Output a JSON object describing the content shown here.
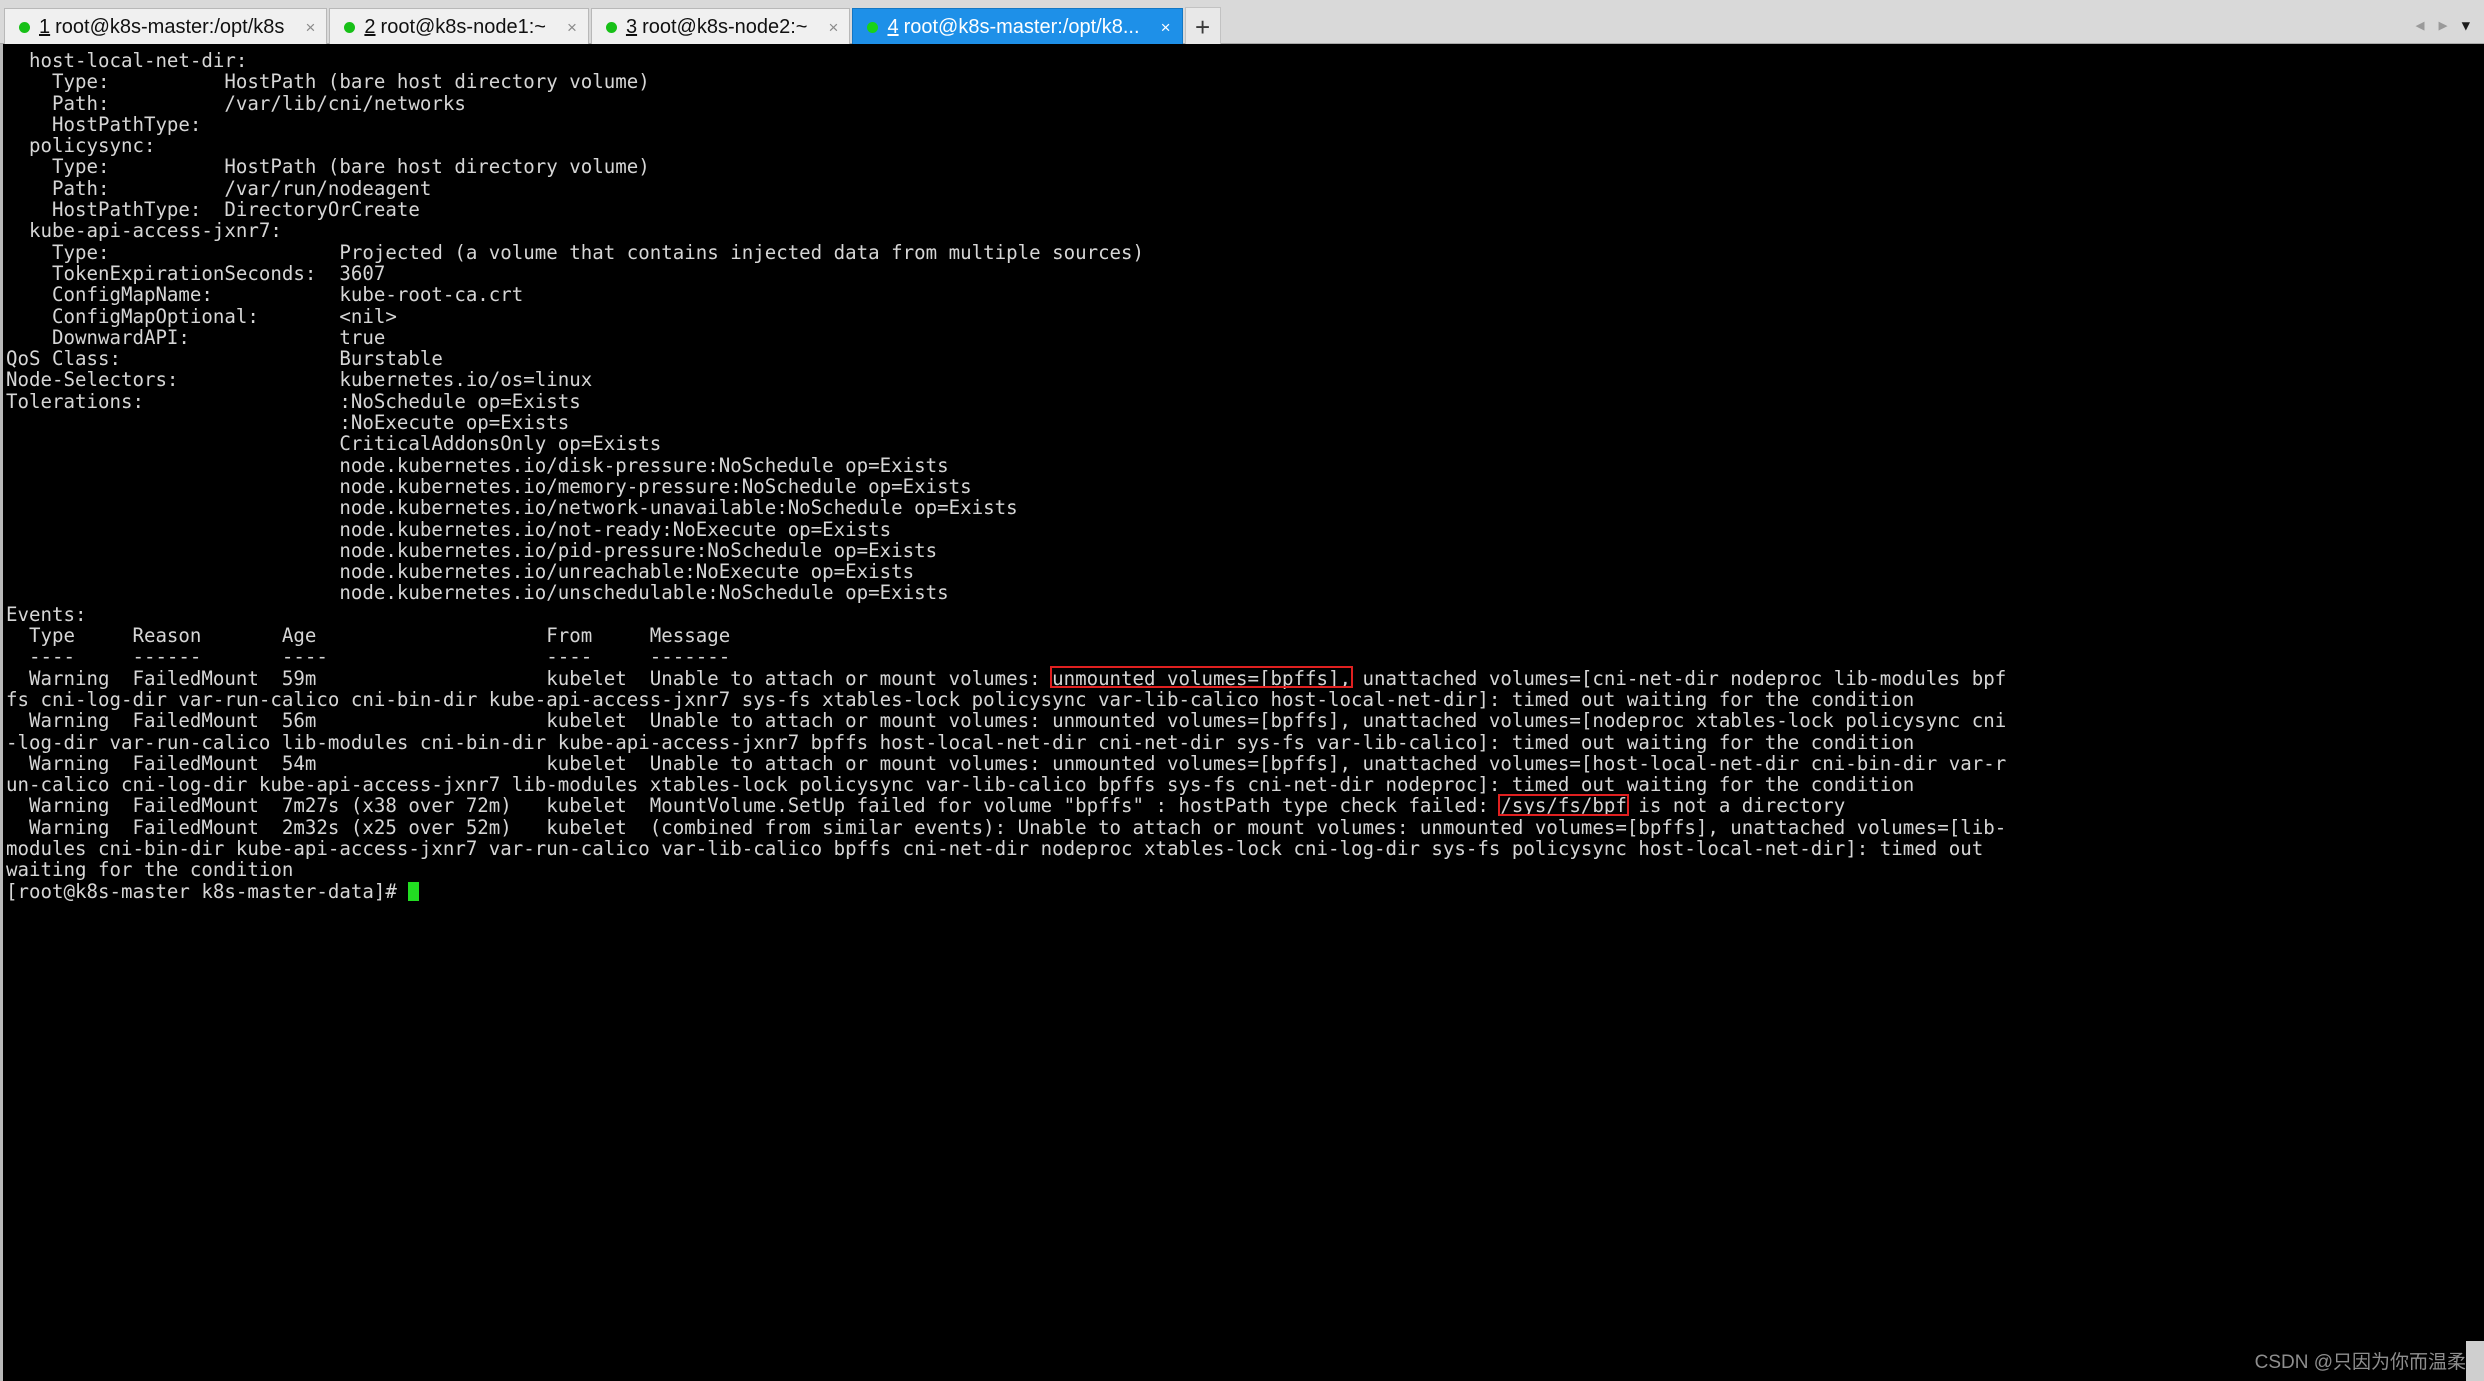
{
  "window": {
    "tabs": [
      {
        "num": "1",
        "title": "root@k8s-master:/opt/k8s",
        "close": "×",
        "active": false
      },
      {
        "num": "2",
        "title": "root@k8s-node1:~",
        "close": "×",
        "active": false
      },
      {
        "num": "3",
        "title": "root@k8s-node2:~",
        "close": "×",
        "active": false
      },
      {
        "num": "4",
        "title": "root@k8s-master:/opt/k8...",
        "close": "×",
        "active": true
      }
    ],
    "new_tab_label": "+",
    "nav": {
      "prev": "◀",
      "next": "▶",
      "menu": "▼"
    }
  },
  "terminal": {
    "lines": [
      "  host-local-net-dir:",
      "    Type:          HostPath (bare host directory volume)",
      "    Path:          /var/lib/cni/networks",
      "    HostPathType:  ",
      "  policysync:",
      "    Type:          HostPath (bare host directory volume)",
      "    Path:          /var/run/nodeagent",
      "    HostPathType:  DirectoryOrCreate",
      "  kube-api-access-jxnr7:",
      "    Type:                    Projected (a volume that contains injected data from multiple sources)",
      "    TokenExpirationSeconds:  3607",
      "    ConfigMapName:           kube-root-ca.crt",
      "    ConfigMapOptional:       <nil>",
      "    DownwardAPI:             true",
      "QoS Class:                   Burstable",
      "Node-Selectors:              kubernetes.io/os=linux",
      "Tolerations:                 :NoSchedule op=Exists",
      "                             :NoExecute op=Exists",
      "                             CriticalAddonsOnly op=Exists",
      "                             node.kubernetes.io/disk-pressure:NoSchedule op=Exists",
      "                             node.kubernetes.io/memory-pressure:NoSchedule op=Exists",
      "                             node.kubernetes.io/network-unavailable:NoSchedule op=Exists",
      "                             node.kubernetes.io/not-ready:NoExecute op=Exists",
      "                             node.kubernetes.io/pid-pressure:NoSchedule op=Exists",
      "                             node.kubernetes.io/unreachable:NoExecute op=Exists",
      "                             node.kubernetes.io/unschedulable:NoSchedule op=Exists",
      "Events:",
      "  Type     Reason       Age                    From     Message",
      "  ----     ------       ----                   ----     -------",
      "  Warning  FailedMount  59m                    kubelet  Unable to attach or mount volumes: unmounted volumes=[bpffs], unattached volumes=[cni-net-dir nodeproc lib-modules bpf",
      "fs cni-log-dir var-run-calico cni-bin-dir kube-api-access-jxnr7 sys-fs xtables-lock policysync var-lib-calico host-local-net-dir]: timed out waiting for the condition",
      "  Warning  FailedMount  56m                    kubelet  Unable to attach or mount volumes: unmounted volumes=[bpffs], unattached volumes=[nodeproc xtables-lock policysync cni",
      "-log-dir var-run-calico lib-modules cni-bin-dir kube-api-access-jxnr7 bpffs host-local-net-dir cni-net-dir sys-fs var-lib-calico]: timed out waiting for the condition",
      "  Warning  FailedMount  54m                    kubelet  Unable to attach or mount volumes: unmounted volumes=[bpffs], unattached volumes=[host-local-net-dir cni-bin-dir var-r",
      "un-calico cni-log-dir kube-api-access-jxnr7 lib-modules xtables-lock policysync var-lib-calico bpffs sys-fs cni-net-dir nodeproc]: timed out waiting for the condition",
      "  Warning  FailedMount  7m27s (x38 over 72m)   kubelet  MountVolume.SetUp failed for volume \"bpffs\" : hostPath type check failed: /sys/fs/bpf is not a directory",
      "  Warning  FailedMount  2m32s (x25 over 52m)   kubelet  (combined from similar events): Unable to attach or mount volumes: unmounted volumes=[bpffs], unattached volumes=[lib-",
      "modules cni-bin-dir kube-api-access-jxnr7 var-run-calico var-lib-calico bpffs cni-net-dir nodeproc xtables-lock cni-log-dir sys-fs policysync host-local-net-dir]: timed out",
      "waiting for the condition",
      "[root@k8s-master k8s-master-data]# "
    ],
    "prompt": "[root@k8s-master k8s-master-data]# ",
    "highlights": [
      {
        "name": "unmounted-volumes-bpffs-highlight",
        "text": "unmounted volumes=[bpffs],"
      },
      {
        "name": "sys-fs-bpf-path-highlight",
        "text": "/sys/fs/bpf"
      }
    ],
    "colors": {
      "background": "#000000",
      "foreground": "#d6d6d6",
      "highlight_border": "#e02020",
      "cursor": "#22dd22",
      "tab_active": "#1e90e8"
    }
  },
  "watermark": {
    "text": "CSDN @只因为你而温柔"
  }
}
